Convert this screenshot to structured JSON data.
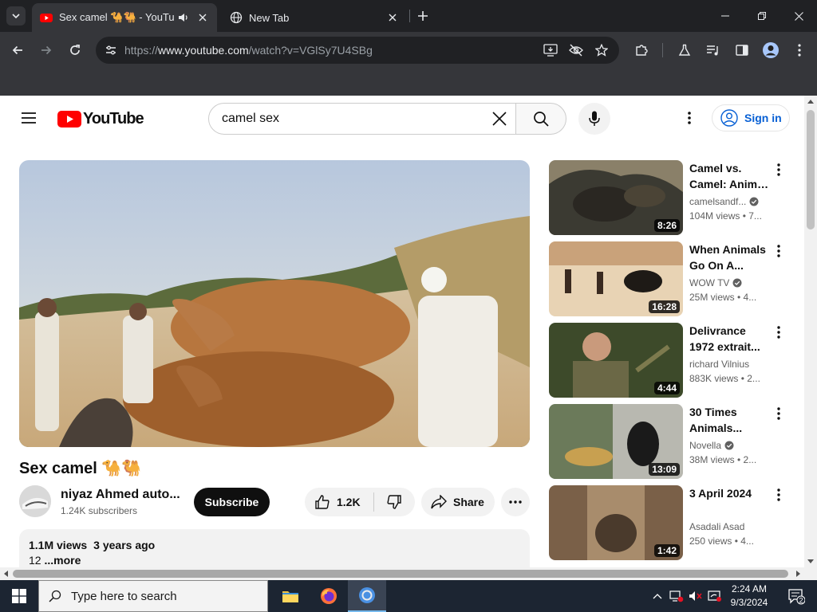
{
  "browser": {
    "tabs": [
      {
        "title": "Sex camel 🐪🐫 - YouTube",
        "active": true
      },
      {
        "title": "New Tab",
        "active": false
      }
    ],
    "address": {
      "prefix": "https://",
      "domain": "www.youtube.com",
      "path": "/watch?v=VGlSy7U4SBg"
    }
  },
  "youtube": {
    "logo_text": "YouTube",
    "search": {
      "query": "camel sex"
    },
    "signin_label": "Sign in",
    "video": {
      "title": "Sex camel 🐪🐫",
      "channel_name": "niyaz Ahmed auto...",
      "subscribers": "1.24K subscribers",
      "subscribe_label": "Subscribe",
      "likes": "1.2K",
      "share_label": "Share",
      "views": "1.1M views",
      "age": "3 years ago",
      "description_snippet": "12",
      "more_label": "...more"
    },
    "recommendations": [
      {
        "title_line1": "Camel vs.",
        "title_line2": "Camel: Anima...",
        "channel": "camelsandf...",
        "verified": true,
        "stats": "104M views • 7...",
        "duration": "8:26",
        "thumb_colors": [
          "#3b3a32",
          "#8a8069"
        ]
      },
      {
        "title_line1": "When Animals",
        "title_line2": "Go On A...",
        "channel": "WOW TV",
        "verified": true,
        "stats": "25M views • 4...",
        "duration": "16:28",
        "thumb_colors": [
          "#c9a27a",
          "#e8d3b4"
        ]
      },
      {
        "title_line1": "Delivrance",
        "title_line2": "1972 extrait...",
        "channel": "richard Vilnius",
        "verified": false,
        "stats": "883K views • 2...",
        "duration": "4:44",
        "thumb_colors": [
          "#3d4a2a",
          "#7d7a4e"
        ]
      },
      {
        "title_line1": "30 Times",
        "title_line2": "Animals...",
        "channel": "Novella",
        "verified": true,
        "stats": "38M views • 2...",
        "duration": "13:09",
        "thumb_colors": [
          "#6b7a5a",
          "#b8b8b0"
        ]
      },
      {
        "title_line1": "3 April 2024",
        "title_line2": "",
        "channel": "Asadali Asad",
        "verified": false,
        "stats": "250 views • 4...",
        "duration": "1:42",
        "thumb_colors": [
          "#7a6048",
          "#a88c6c"
        ]
      }
    ]
  },
  "taskbar": {
    "search_placeholder": "Type here to search",
    "time": "2:24 AM",
    "date": "9/3/2024",
    "notification_count": "2"
  },
  "colors": {
    "youtube_red": "#ff0000",
    "link_blue": "#065fd4",
    "taskbar": "#1c2532"
  }
}
